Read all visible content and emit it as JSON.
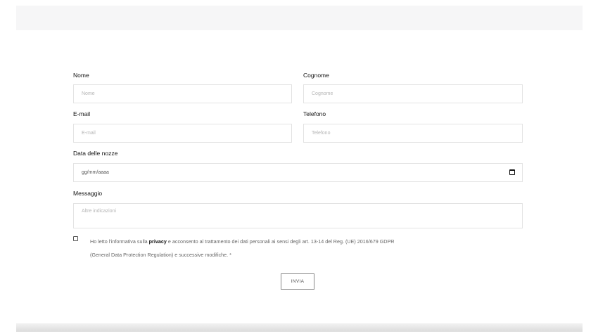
{
  "form": {
    "nome": {
      "label": "Nome",
      "placeholder": "Nome"
    },
    "cognome": {
      "label": "Cognome",
      "placeholder": "Cognome"
    },
    "email": {
      "label": "E-mail",
      "placeholder": "E-mail"
    },
    "telefono": {
      "label": "Telefono",
      "placeholder": "Telefono"
    },
    "data": {
      "label": "Data delle nozze",
      "placeholder": "gg/mm/aaaa"
    },
    "messaggio": {
      "label": "Messaggio",
      "placeholder": "Altre indicazioni"
    },
    "consent": {
      "before": "Ho letto l'informativa sulla ",
      "bold": "privacy",
      "after_line1": " e acconsento al trattamento dei dati personali ai sensi degli art. 13-14 del Reg. (UE) 2016/679 GDPR",
      "line2": "(General Data Protection Regulation) e successive modifiche. *"
    },
    "submit_label": "INVIA"
  },
  "icons": {
    "date_picker": "calendar-icon"
  }
}
